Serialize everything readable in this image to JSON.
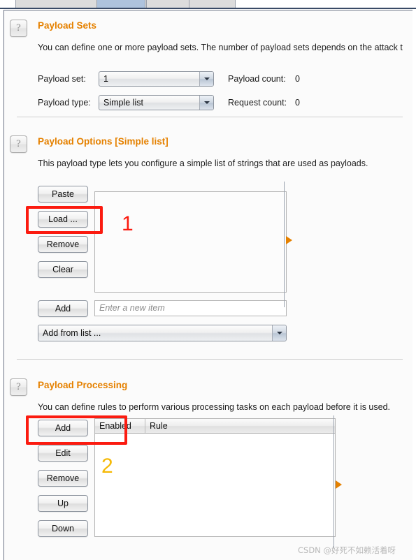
{
  "window": {
    "tabs": [
      {
        "label": "",
        "active": false
      },
      {
        "label": "",
        "active": false
      },
      {
        "label": "",
        "active": true
      },
      {
        "label": "",
        "active": false
      }
    ]
  },
  "payload_sets": {
    "help_icon": "question-mark-icon",
    "title": "Payload Sets",
    "description": "You can define one or more payload sets. The number of payload sets depends on the attack t",
    "payload_set_label": "Payload set:",
    "payload_set_value": "1",
    "payload_type_label": "Payload type:",
    "payload_type_value": "Simple list",
    "payload_count_label": "Payload count:",
    "payload_count_value": "0",
    "request_count_label": "Request count:",
    "request_count_value": "0"
  },
  "payload_options": {
    "help_icon": "question-mark-icon",
    "title": "Payload Options [Simple list]",
    "description": "This payload type lets you configure a simple list of strings that are used as payloads.",
    "buttons": [
      {
        "label": "Paste"
      },
      {
        "label": "Load ..."
      },
      {
        "label": "Remove"
      },
      {
        "label": "Clear"
      }
    ],
    "list_items": [],
    "add_button_label": "Add",
    "new_item_placeholder": "Enter a new item",
    "add_from_list_value": "Add from list ...",
    "expand_icon": "triangle-right-icon"
  },
  "payload_processing": {
    "help_icon": "question-mark-icon",
    "title": "Payload Processing",
    "description": "You can define rules to perform various processing tasks on each payload before it is used.",
    "buttons": [
      {
        "label": "Add"
      },
      {
        "label": "Edit"
      },
      {
        "label": "Remove"
      },
      {
        "label": "Up"
      },
      {
        "label": "Down"
      }
    ],
    "table": {
      "columns": [
        "Enabled",
        "Rule"
      ],
      "rows": []
    },
    "expand_icon": "triangle-right-icon"
  },
  "annotations": [
    {
      "number": "1",
      "color": "#fb1b10"
    },
    {
      "number": "2",
      "color": "#f5b906"
    }
  ],
  "watermark": {
    "text": "CSDN @好死不如赖活着呀"
  },
  "colors": {
    "accent_orange": "#e58100",
    "annotation_red": "#fb1b10",
    "annotation_gold": "#f5b906",
    "panel_bg": "#fbfbfb"
  }
}
